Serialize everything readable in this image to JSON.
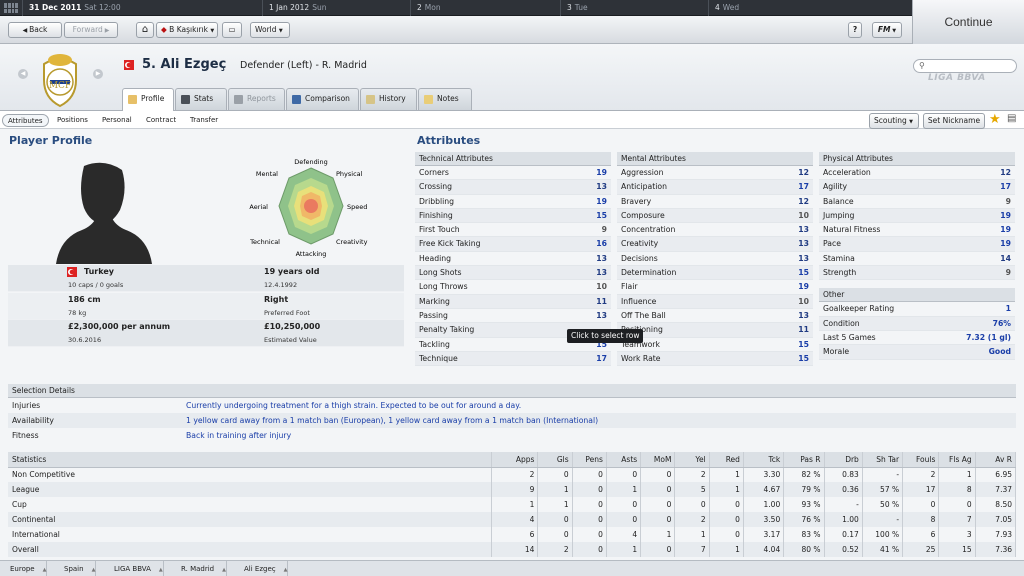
{
  "calendar": {
    "current_date": "31 Dec 2011",
    "current_day_time": "Sat 12:00",
    "days": [
      {
        "date": "1 Jan 2012",
        "day": "Sun"
      },
      {
        "date": "2",
        "day": "Mon"
      },
      {
        "date": "3",
        "day": "Tue"
      },
      {
        "date": "4",
        "day": "Wed"
      }
    ]
  },
  "toolbar": {
    "back_label": "Back",
    "forward_label": "Forward",
    "club_label": "B Kaşıkırık",
    "world_label": "World",
    "help_label": "?",
    "fm_label": "FM",
    "continue_label": "Continue"
  },
  "player": {
    "title": "5. Ali Ezgeç",
    "role": "Defender (Left) - R. Madrid",
    "league_logo_text": "LIGA BBVA"
  },
  "tabs": [
    {
      "label": "Profile"
    },
    {
      "label": "Stats"
    },
    {
      "label": "Reports"
    },
    {
      "label": "Comparison"
    },
    {
      "label": "History"
    },
    {
      "label": "Notes"
    }
  ],
  "subtabs": [
    {
      "label": "Attributes"
    },
    {
      "label": "Positions"
    },
    {
      "label": "Personal"
    },
    {
      "label": "Contract"
    },
    {
      "label": "Transfer"
    }
  ],
  "actions": {
    "scouting_label": "Scouting",
    "nickname_label": "Set Nickname"
  },
  "profile": {
    "heading": "Player Profile",
    "nationality": "Turkey",
    "caps": "10 caps / 0 goals",
    "age": "19 years old",
    "dob": "12.4.1992",
    "height": "186 cm",
    "weight": "78 kg",
    "foot": "Right",
    "foot_label": "Preferred Foot",
    "wage": "£2,300,000 per annum",
    "contract_end": "30.6.2016",
    "value": "£10,250,000",
    "value_label": "Estimated Value"
  },
  "radar": {
    "labels": [
      "Defending",
      "Physical",
      "Speed",
      "Creativity",
      "Attacking",
      "Technical",
      "Aerial",
      "Mental"
    ]
  },
  "attributes": {
    "heading": "Attributes",
    "technical_title": "Technical Attributes",
    "technical": [
      {
        "name": "Corners",
        "value": "19"
      },
      {
        "name": "Crossing",
        "value": "13"
      },
      {
        "name": "Dribbling",
        "value": "19"
      },
      {
        "name": "Finishing",
        "value": "15"
      },
      {
        "name": "First Touch",
        "value": "9"
      },
      {
        "name": "Free Kick Taking",
        "value": "16"
      },
      {
        "name": "Heading",
        "value": "13"
      },
      {
        "name": "Long Shots",
        "value": "13"
      },
      {
        "name": "Long Throws",
        "value": "10"
      },
      {
        "name": "Marking",
        "value": "11"
      },
      {
        "name": "Passing",
        "value": "13"
      },
      {
        "name": "Penalty Taking",
        "value": ""
      },
      {
        "name": "Tackling",
        "value": "15"
      },
      {
        "name": "Technique",
        "value": "17"
      }
    ],
    "mental_title": "Mental Attributes",
    "mental": [
      {
        "name": "Aggression",
        "value": "12"
      },
      {
        "name": "Anticipation",
        "value": "17"
      },
      {
        "name": "Bravery",
        "value": "12"
      },
      {
        "name": "Composure",
        "value": "10"
      },
      {
        "name": "Concentration",
        "value": "13"
      },
      {
        "name": "Creativity",
        "value": "13"
      },
      {
        "name": "Decisions",
        "value": "13"
      },
      {
        "name": "Determination",
        "value": "15"
      },
      {
        "name": "Flair",
        "value": "19"
      },
      {
        "name": "Influence",
        "value": "10"
      },
      {
        "name": "Off The Ball",
        "value": "13"
      },
      {
        "name": "Positioning",
        "value": "11"
      },
      {
        "name": "Teamwork",
        "value": "15"
      },
      {
        "name": "Work Rate",
        "value": "15"
      }
    ],
    "physical_title": "Physical Attributes",
    "physical": [
      {
        "name": "Acceleration",
        "value": "12"
      },
      {
        "name": "Agility",
        "value": "17"
      },
      {
        "name": "Balance",
        "value": "9"
      },
      {
        "name": "Jumping",
        "value": "19"
      },
      {
        "name": "Natural Fitness",
        "value": "19"
      },
      {
        "name": "Pace",
        "value": "19"
      },
      {
        "name": "Stamina",
        "value": "14"
      },
      {
        "name": "Strength",
        "value": "9"
      }
    ],
    "other_title": "Other",
    "other": [
      {
        "name": "Goalkeeper Rating",
        "value": "1"
      },
      {
        "name": "Condition",
        "value": "76%"
      },
      {
        "name": "Last 5 Games",
        "value": "7.32 (1 gl)"
      },
      {
        "name": "Morale",
        "value": "Good"
      }
    ]
  },
  "tooltip": "Click to select row",
  "selection": {
    "title": "Selection Details",
    "rows": [
      {
        "key": "Injuries",
        "value": "Currently undergoing treatment for a thigh strain. Expected to be out for around a day."
      },
      {
        "key": "Availability",
        "value": "1 yellow card away from a 1 match ban (European), 1 yellow card away from a 1 match ban (International)"
      },
      {
        "key": "Fitness",
        "value": "Back in training after injury"
      }
    ]
  },
  "statistics": {
    "columns": [
      "Statistics",
      "Apps",
      "Gls",
      "Pens",
      "Asts",
      "MoM",
      "Yel",
      "Red",
      "Tck",
      "Pas R",
      "Drb",
      "Sh Tar",
      "Fouls",
      "Fls Ag",
      "Av R"
    ],
    "rows": [
      [
        "Non Competitive",
        "2",
        "0",
        "0",
        "0",
        "0",
        "2",
        "1",
        "3.30",
        "82 %",
        "0.83",
        "-",
        "2",
        "1",
        "6.95"
      ],
      [
        "League",
        "9",
        "1",
        "0",
        "1",
        "0",
        "5",
        "1",
        "4.67",
        "79 %",
        "0.36",
        "57 %",
        "17",
        "8",
        "7.37"
      ],
      [
        "Cup",
        "1",
        "1",
        "0",
        "0",
        "0",
        "0",
        "0",
        "1.00",
        "93 %",
        "-",
        "50 %",
        "0",
        "0",
        "8.50"
      ],
      [
        "Continental",
        "4",
        "0",
        "0",
        "0",
        "0",
        "2",
        "0",
        "3.50",
        "76 %",
        "1.00",
        "-",
        "8",
        "7",
        "7.05"
      ],
      [
        "International",
        "6",
        "0",
        "0",
        "4",
        "1",
        "1",
        "0",
        "3.17",
        "83 %",
        "0.17",
        "100 %",
        "6",
        "3",
        "7.93"
      ],
      [
        "Overall",
        "14",
        "2",
        "0",
        "1",
        "0",
        "7",
        "1",
        "4.04",
        "80 %",
        "0.52",
        "41 %",
        "25",
        "15",
        "7.36"
      ]
    ]
  },
  "breadcrumbs": [
    "Europe",
    "Spain",
    "LIGA BBVA",
    "R. Madrid",
    "Ali Ezgeç"
  ],
  "colors": {
    "accent": "#2a4d80",
    "attr_high": "#1a3ea8"
  }
}
